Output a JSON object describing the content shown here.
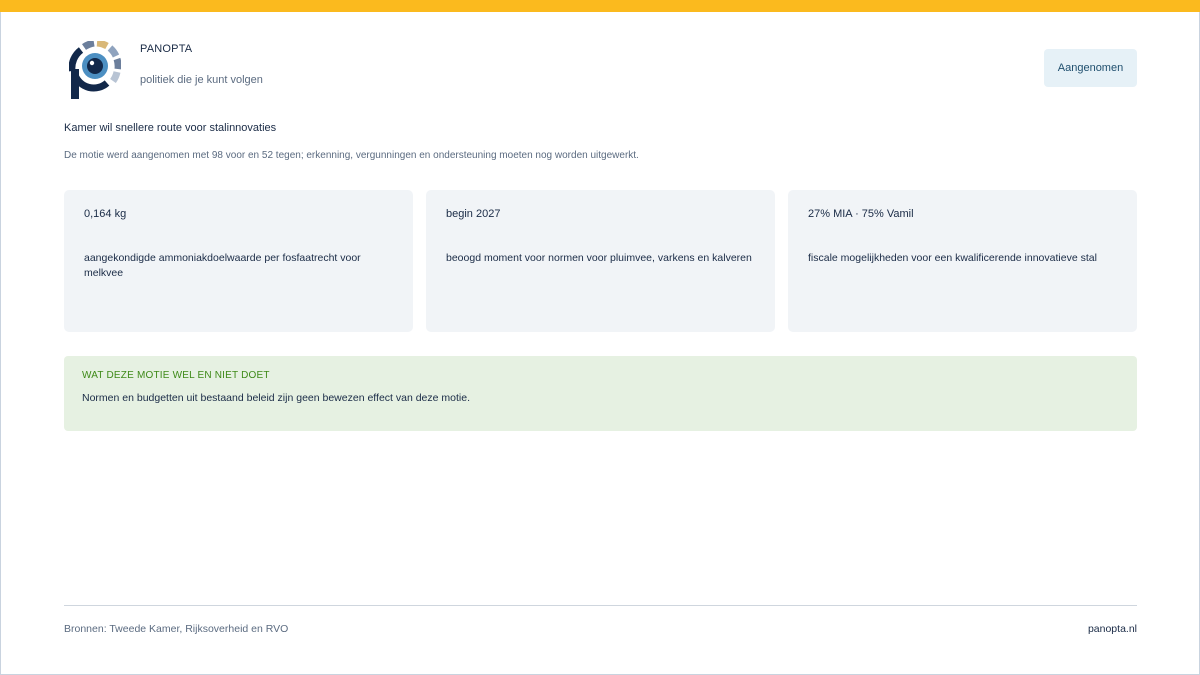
{
  "brand": {
    "name": "PANOPTA",
    "tagline": "politiek die je kunt volgen",
    "colors": {
      "accent": "#fbba1e",
      "navy": "#12284a"
    },
    "logo_icon": "panopta-eye-logo"
  },
  "status": {
    "label": "Aangenomen"
  },
  "headline": "Kamer wil snellere route voor stalinnovaties",
  "summary": "De motie werd aangenomen met 98 voor en 52 tegen; erkenning, vergunningen en ondersteuning moeten nog worden uitgewerkt.",
  "stats": [
    {
      "value": "0,164 kg",
      "description": "aangekondigde ammoniakdoelwaarde per fosfaatrecht voor melkvee"
    },
    {
      "value": "begin 2027",
      "description": "beoogd moment voor normen voor pluimvee, varkens en kalveren"
    },
    {
      "value": "27% MIA · 75% Vamil",
      "description": "fiscale mogelijkheden voor een kwalificerende innovatieve stal"
    }
  ],
  "note": {
    "title": "WAT DEZE MOTIE WEL EN NIET DOET",
    "text": "Normen en budgetten uit bestaand beleid zijn geen bewezen effect van deze motie."
  },
  "footer": {
    "sources": "Bronnen: Tweede Kamer, Rijksoverheid en RVO",
    "site": "panopta.nl"
  }
}
